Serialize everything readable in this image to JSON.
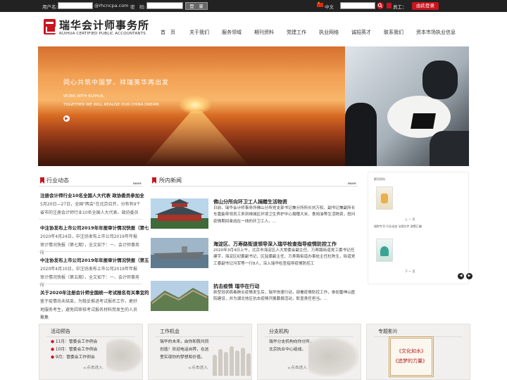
{
  "topbar": {
    "username_label": "用户名:",
    "email_suffix": "@rhcncpa.com",
    "password_label": "密　码:",
    "login_button": "登　录",
    "lang_label": "中文",
    "employee_label": "员工：",
    "oa_button": "由此登录"
  },
  "header": {
    "logo_cn": "瑞华会计师事务所",
    "logo_en": "RUIHUA CERTIFIED PUBLIC ACCOUNTANTS",
    "nav": [
      "首　页",
      "关于我们",
      "服务领域",
      "期刊资料",
      "党建工作",
      "执业网络",
      "诚招英才",
      "联系我们",
      "资本市场执业信息"
    ]
  },
  "banner": {
    "slogan": "同心共筑中国梦、祥瑞英华再出发",
    "en_line1": "WORK WITH RUIHUA,",
    "en_line2": "TOGETHER WE WILL REALISE OUR CHINA DREAM."
  },
  "industry": {
    "title": "行业动态",
    "more": "more",
    "items": [
      {
        "title": "注册会计师行业10名全国人大代表 政协委员参加全",
        "body": "5月20日—27日，全国\"两会\"在北京召开，分布有9个省市的注册会计师行业10名全国人大代表、政协委员"
      },
      {
        "title": "中注协发布上市公司2019年年报审计情况快报（第七",
        "body": "2020年4月24日，中注协发布上市公司2019年年报审计情况快报（第七期），全文如下：一、会计师事务所"
      },
      {
        "title": "中注协发布上市公司2019年年报审计情况快报（第五",
        "body": "2020年4月10日，中注协发布上市公司2019年年报审计情况快报（第五期），全文如下：一、会计师事务所"
      },
      {
        "title": "关于2020年注册会计师全国统一考试报名有关事宜的",
        "body": "鉴于疫情尚未结束，为稳妥推进考试报名工作，更好地服务考生，避免因审核考试报名材料而发生的人员聚集"
      }
    ]
  },
  "firm_news": {
    "title": "所内新闻",
    "more": "more",
    "items": [
      {
        "title": "佛山分所向环卫工人捐赠生活物资",
        "body": "日前，瑞华会计师事务所佛山分所党支部书记兼分所所长刘万权、副书记兼副所长车嘉能带领员工来到禅城区环境卫生养护中心捐赠大米、食用油等生活物资，慰问疫情期间奋战在一线的环卫工人。..."
      },
      {
        "title": "海淀区、万寿路街道领导深入瑞华检查指导疫情防控工作",
        "body": "2020年3月4日上午，北京市海淀区人大常委会副主任、万寿路街道党工委书记任建宇，海淀区纪委副书记、区监委副主任、万寿路街道办事处主任杜陈生，街道党工委副书记冯军等一行8人，深入瑞华检查指导疫情防控工"
      },
      {
        "title": "抗击疫情 瑞华在行动",
        "body": "新型冠状病毒肺炎疫情发生后，瑞华快速行动，部署疫情防控工作，参加雷神山医院建设，并为湖北地区抗击疫情开展募捐活动，彰显责任担当。..."
      }
    ]
  },
  "magazine": {
    "label1": "期刊资料",
    "caption1": "瑞财专刊 行业动态 法规文件 政策汇编",
    "caption2": "瑞财专刊 行业动态 法规文件 政策汇编 研究文章 简报 政策文件",
    "page1": "上 一 页",
    "page2": "下 一 页",
    "prev": "◀",
    "next": "▶"
  },
  "bottom": {
    "events": {
      "title": "活动预告",
      "items": [
        "11月：管委会工作例会",
        "10月：管委会工作例会",
        "9月：管委会工作例会"
      ],
      "enter": "点击进入"
    },
    "jobs": {
      "title": "工作机会",
      "lines": [
        "瑞华的未来，由你和我共同",
        "创造！欢迎电话自荐，在这",
        "里实现你的梦想和价值。"
      ],
      "enter": "点击进入"
    },
    "branches": {
      "title": "分支机构",
      "lines": [
        "瑞华分支机构向你分所，",
        "北京执业中心组成。"
      ],
      "enter": "点击进入"
    },
    "films": {
      "title": "专题影片",
      "films": [
        "《文化如水》",
        "《追梦的力量》"
      ]
    }
  }
}
